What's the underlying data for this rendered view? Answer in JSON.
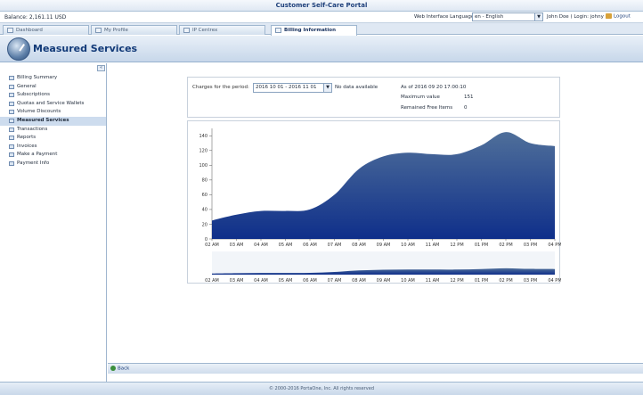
{
  "window": {
    "title": "Customer Self-Care Portal"
  },
  "info": {
    "balance": "Balance: 2,161.11 USD",
    "language_label": "Web Interface Language",
    "language_value": "en - English",
    "user": "John Doe ( Login: johny )",
    "logout": "Logout"
  },
  "tabs": [
    {
      "label": "Dashboard",
      "active": false
    },
    {
      "label": "My Profile",
      "active": false
    },
    {
      "label": "IP Centrex",
      "active": false
    },
    {
      "label": "Billing Information",
      "active": true
    }
  ],
  "page": {
    "title": "Measured Services"
  },
  "sidebar": {
    "collapse": "«",
    "items": [
      {
        "label": "Billing Summary",
        "active": false
      },
      {
        "label": "General",
        "active": false
      },
      {
        "label": "Subscriptions",
        "active": false
      },
      {
        "label": "Quotas and Service Wallets",
        "active": false
      },
      {
        "label": "Volume Discounts",
        "active": false
      },
      {
        "label": "Measured Services",
        "active": true
      },
      {
        "label": "Transactions",
        "active": false
      },
      {
        "label": "Reports",
        "active": false
      },
      {
        "label": "Invoices",
        "active": false
      },
      {
        "label": "Make a Payment",
        "active": false
      },
      {
        "label": "Payment Info",
        "active": false
      }
    ]
  },
  "period": {
    "label": "Charges for the period:",
    "value": "2016 10 01 - 2016 11 01",
    "no_data": "No data available",
    "as_of": "As of 2016 09 20 17:00:10",
    "max_label": "Maximum value",
    "max_value": "151",
    "remaining_label": "Remained Free Items",
    "remaining_value": "0"
  },
  "chart_data": {
    "type": "area",
    "x": [
      "02 AM",
      "03 AM",
      "04 AM",
      "05 AM",
      "06 AM",
      "07 AM",
      "08 AM",
      "09 AM",
      "10 AM",
      "11 AM",
      "12 PM",
      "01 PM",
      "02 PM",
      "03 PM",
      "04 PM"
    ],
    "values": [
      25,
      33,
      38,
      38,
      40,
      60,
      95,
      112,
      117,
      115,
      115,
      127,
      145,
      130,
      126
    ],
    "yticks": [
      0,
      20,
      40,
      60,
      80,
      100,
      120,
      140
    ],
    "ylim": [
      0,
      150
    ],
    "color_top": "#4f6f9a",
    "color_bottom": "#0f2f8a"
  },
  "footer": {
    "back": "Back",
    "copyright": "© 2000-2016 PortaOne, Inc. All rights reserved"
  }
}
